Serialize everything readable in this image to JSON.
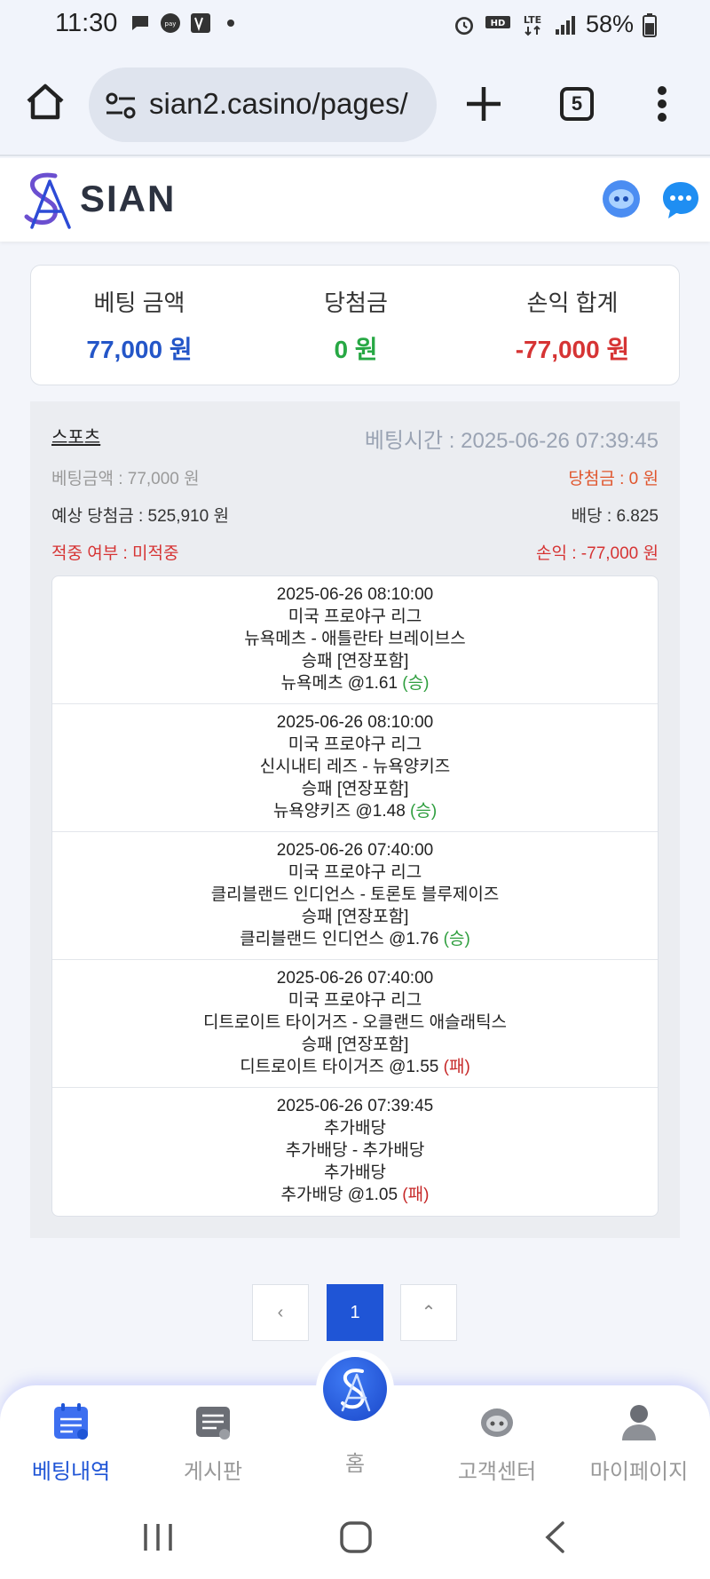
{
  "status": {
    "time": "11:30",
    "battery": "58%"
  },
  "browser": {
    "url": "sian2.casino/pages/",
    "tab_count": "5"
  },
  "site": {
    "brand": "SIAN"
  },
  "summary": {
    "bet_label": "베팅 금액",
    "bet_value": "77,000 원",
    "win_label": "당첨금",
    "win_value": "0 원",
    "pl_label": "손익 합계",
    "pl_value": "-77,000 원"
  },
  "bet": {
    "category": "스포츠",
    "bet_time": "베팅시간 : 2025-06-26 07:39:45",
    "bet_amount": "베팅금액 : 77,000 원",
    "win_amount": "당첨금 : 0 원",
    "expected_win": "예상 당첨금 : 525,910 원",
    "odds": "배당 : 6.825",
    "hit_status": "적중 여부 : 미적중",
    "profit_loss": "손익 : -77,000 원",
    "games": [
      {
        "time": "2025-06-26 08:10:00",
        "league": "미국 프로야구 리그",
        "match": "뉴욕메츠 - 애틀란타 브레이브스",
        "market": "승패 [연장포함]",
        "pick": "뉴욕메츠 @1.61 ",
        "result": "(승)",
        "result_type": "win"
      },
      {
        "time": "2025-06-26 08:10:00",
        "league": "미국 프로야구 리그",
        "match": "신시내티 레즈 - 뉴욕양키즈",
        "market": "승패 [연장포함]",
        "pick": "뉴욕양키즈 @1.48 ",
        "result": "(승)",
        "result_type": "win"
      },
      {
        "time": "2025-06-26 07:40:00",
        "league": "미국 프로야구 리그",
        "match": "클리블랜드 인디언스 - 토론토 블루제이즈",
        "market": "승패 [연장포함]",
        "pick": "클리블랜드 인디언스 @1.76 ",
        "result": "(승)",
        "result_type": "win"
      },
      {
        "time": "2025-06-26 07:40:00",
        "league": "미국 프로야구 리그",
        "match": "디트로이트 타이거즈 - 오클랜드 애슬래틱스",
        "market": "승패 [연장포함]",
        "pick": "디트로이트 타이거즈 @1.55 ",
        "result": "(패)",
        "result_type": "loss"
      },
      {
        "time": "2025-06-26 07:39:45",
        "league": "추가배당",
        "match": "추가배당 - 추가배당",
        "market": "추가배당",
        "pick": "추가배당 @1.05 ",
        "result": "(패)",
        "result_type": "loss"
      }
    ]
  },
  "pagination": {
    "prev": "‹",
    "current": "1",
    "top": "⌃"
  },
  "nav": {
    "bets": "베팅내역",
    "board": "게시판",
    "home": "홈",
    "support": "고객센터",
    "mypage": "마이페이지"
  },
  "colors": {
    "blue": "#2456c8",
    "green": "#27a844",
    "red": "#d63434",
    "win": "#2e9e3e",
    "loss": "#c62828"
  }
}
